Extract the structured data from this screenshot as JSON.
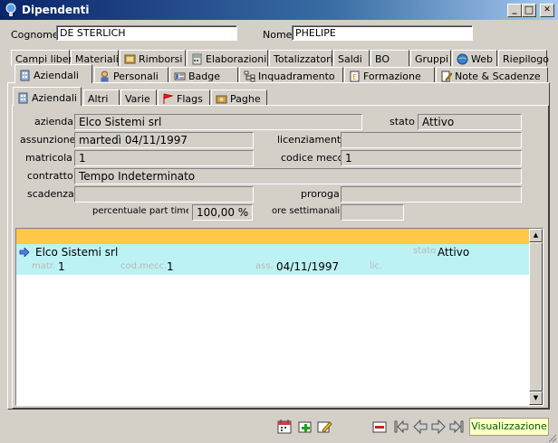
{
  "window": {
    "title": "Dipendenti",
    "minimize": "_",
    "maximize": "□",
    "close": "✕"
  },
  "header": {
    "cognome_label": "Cognome",
    "cognome_value": "DE STERLICH",
    "nome_label": "Nome",
    "nome_value": "PHELIPE"
  },
  "tabs_row1": [
    "Campi liberi",
    "Materiali",
    "Rimborsi",
    "Elaborazioni",
    "Totalizzatori",
    "Saldi",
    "BO",
    "Gruppi",
    "Web",
    "Riepilogo"
  ],
  "tabs_row2": [
    "Aziendali",
    "Personali",
    "Badge",
    "Inquadramento",
    "Formazione",
    "Note & Scadenze"
  ],
  "tabs_row3": [
    "Aziendali",
    "Altri",
    "Varie",
    "Flags",
    "Paghe"
  ],
  "form": {
    "azienda_label": "azienda",
    "azienda_value": "Elco Sistemi srl",
    "stato_label": "stato",
    "stato_value": "Attivo",
    "assunzione_label": "assunzione",
    "assunzione_value": "martedì 04/11/1997",
    "licenziamento_label": "licenziamento",
    "licenziamento_value": "",
    "matricola_label": "matricola",
    "matricola_value": "1",
    "codice_mecc_label": "codice mecc.",
    "codice_mecc_value": "1",
    "contratto_label": "contratto",
    "contratto_value": "Tempo Indeterminato",
    "scadenza_label": "scadenza",
    "scadenza_value": "",
    "proroga_label": "proroga",
    "proroga_value": "",
    "part_time_label": "percentuale part time",
    "part_time_value": "100,00 %",
    "ore_label": "ore settimanali",
    "ore_value": ""
  },
  "list": {
    "row": {
      "azienda": "Elco Sistemi srl",
      "stato_label": "stato",
      "stato": "Attivo",
      "matr_label": "matr.",
      "matr": "1",
      "codmecc_label": "cod.mecc.",
      "codmecc": "1",
      "ass_label": "ass.",
      "ass": "04/11/1997",
      "lic_label": "lic.",
      "lic": ""
    }
  },
  "status": {
    "mode": "Visualizzazione"
  },
  "colors": {
    "list_header": "#ffc847",
    "selected_row": "#bdf2f4",
    "status_bg": "#ffffc8"
  }
}
